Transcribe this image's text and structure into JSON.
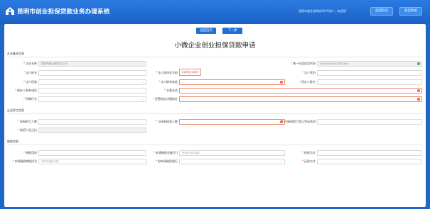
{
  "header": {
    "title": "昆明市创业担保贷款业务办理系统",
    "welcome": "昆明市就业局网站2019用户，欢迎您!",
    "btn_home": "返回首页",
    "btn_logout": "退出系统"
  },
  "actions": {
    "back": "返回首页",
    "next": "下一步"
  },
  "form_title": "小微企业创业担保贷款申请",
  "sections": {
    "basic": "企业基本信息",
    "staff": "企业职工信息",
    "loan": "借款信息"
  },
  "basic": {
    "company_name": {
      "label": "企业名称",
      "value": "昆明市就业局测试2019"
    },
    "credit_code": {
      "label": "统一社会信用代码",
      "value": "91XXXXXXXXXXXXXXX"
    },
    "legal_name": {
      "label": "法人姓名",
      "value": ""
    },
    "legal_id": {
      "label": "法人身份证号码",
      "value": ""
    },
    "legal_gender": {
      "label": "法人性别",
      "value": ""
    },
    "legal_ethnic": {
      "label": "法人民族",
      "value": ""
    },
    "legal_phone": {
      "label": "法人联系电话",
      "value": ""
    },
    "operator_name": {
      "label": "经办人姓名",
      "value": ""
    },
    "operator_phone": {
      "label": "经办人联系电话",
      "value": ""
    },
    "main_business": {
      "label": "主营业务",
      "value": ""
    },
    "industry": {
      "label": "所属行业",
      "value": ""
    },
    "license_address": {
      "label": "经营地址详细地址",
      "value": ""
    },
    "tip": "必填项目未填写"
  },
  "staff": {
    "current_staff": {
      "label": "现有职工人数",
      "value": ""
    },
    "new_staff": {
      "label": "当年新招录人数",
      "value": ""
    },
    "contract_staff": {
      "label": "与新招职工签订劳动合同",
      "value": ""
    },
    "ratio": {
      "label": "新招人员占比",
      "value": ""
    }
  },
  "loan": {
    "purpose": {
      "label": "借款用途",
      "value": ""
    },
    "amount": {
      "label": "申请借款金额(万)",
      "placeholder": "请填写申请金额"
    },
    "guarantee": {
      "label": "担保方式",
      "value": ""
    },
    "term": {
      "label": "申请借款期限(月)",
      "placeholder": "请填写借款月数"
    },
    "bank": {
      "label": "拟申请借款银行",
      "value": ""
    },
    "repay": {
      "label": "还款方式",
      "value": ""
    }
  },
  "colors": {
    "primary": "#1f6fd6",
    "header": "#2b7ae0",
    "error": "#e2513b",
    "ok": "#36b24a"
  }
}
